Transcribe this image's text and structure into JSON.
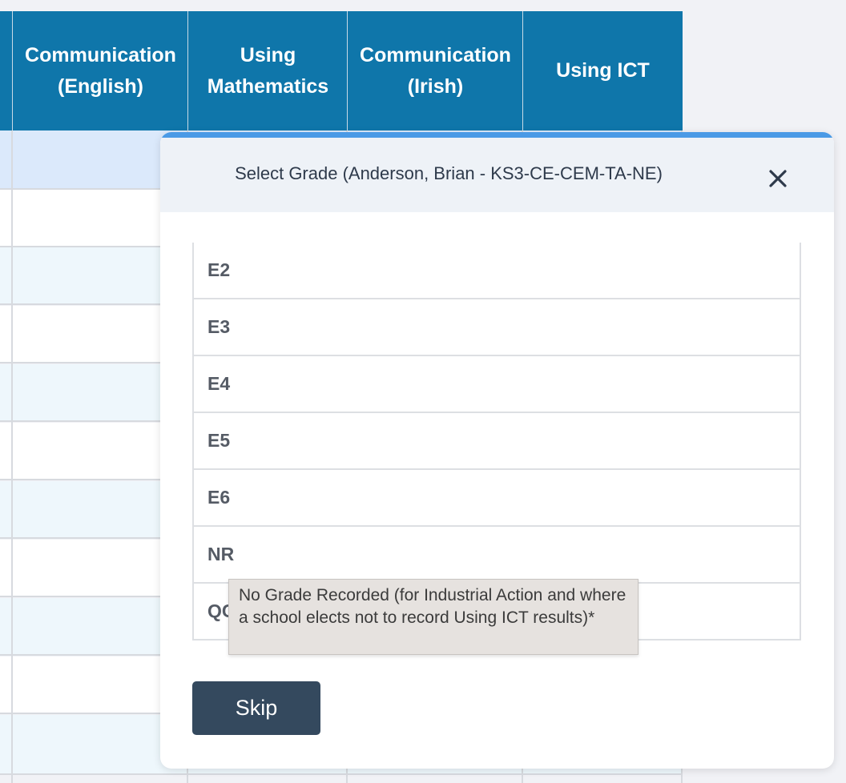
{
  "table": {
    "headers": [
      {
        "line1": "Communication",
        "line2": "(English)"
      },
      {
        "line1": "Using",
        "line2": "Mathematics"
      },
      {
        "line1": "Communication",
        "line2": "(Irish)"
      },
      {
        "line1": "Using ICT",
        "line2": ""
      }
    ]
  },
  "modal": {
    "title": "Select Grade (Anderson, Brian - KS3-CE-CEM-TA-NE)",
    "close_icon": "close-icon",
    "options": [
      "E2",
      "E3",
      "E4",
      "E5",
      "E6",
      "NR",
      "QC"
    ],
    "skip_label": "Skip",
    "tooltip": "No Grade Recorded (for Industrial Action and where a school elects not to record Using ICT results)*"
  },
  "colors": {
    "header_bg": "#0f76aa",
    "modal_accent": "#4a9ae6",
    "skip_button": "#34495e",
    "row_highlight": "#dbe9fb",
    "row_alt": "#eef7fc"
  }
}
